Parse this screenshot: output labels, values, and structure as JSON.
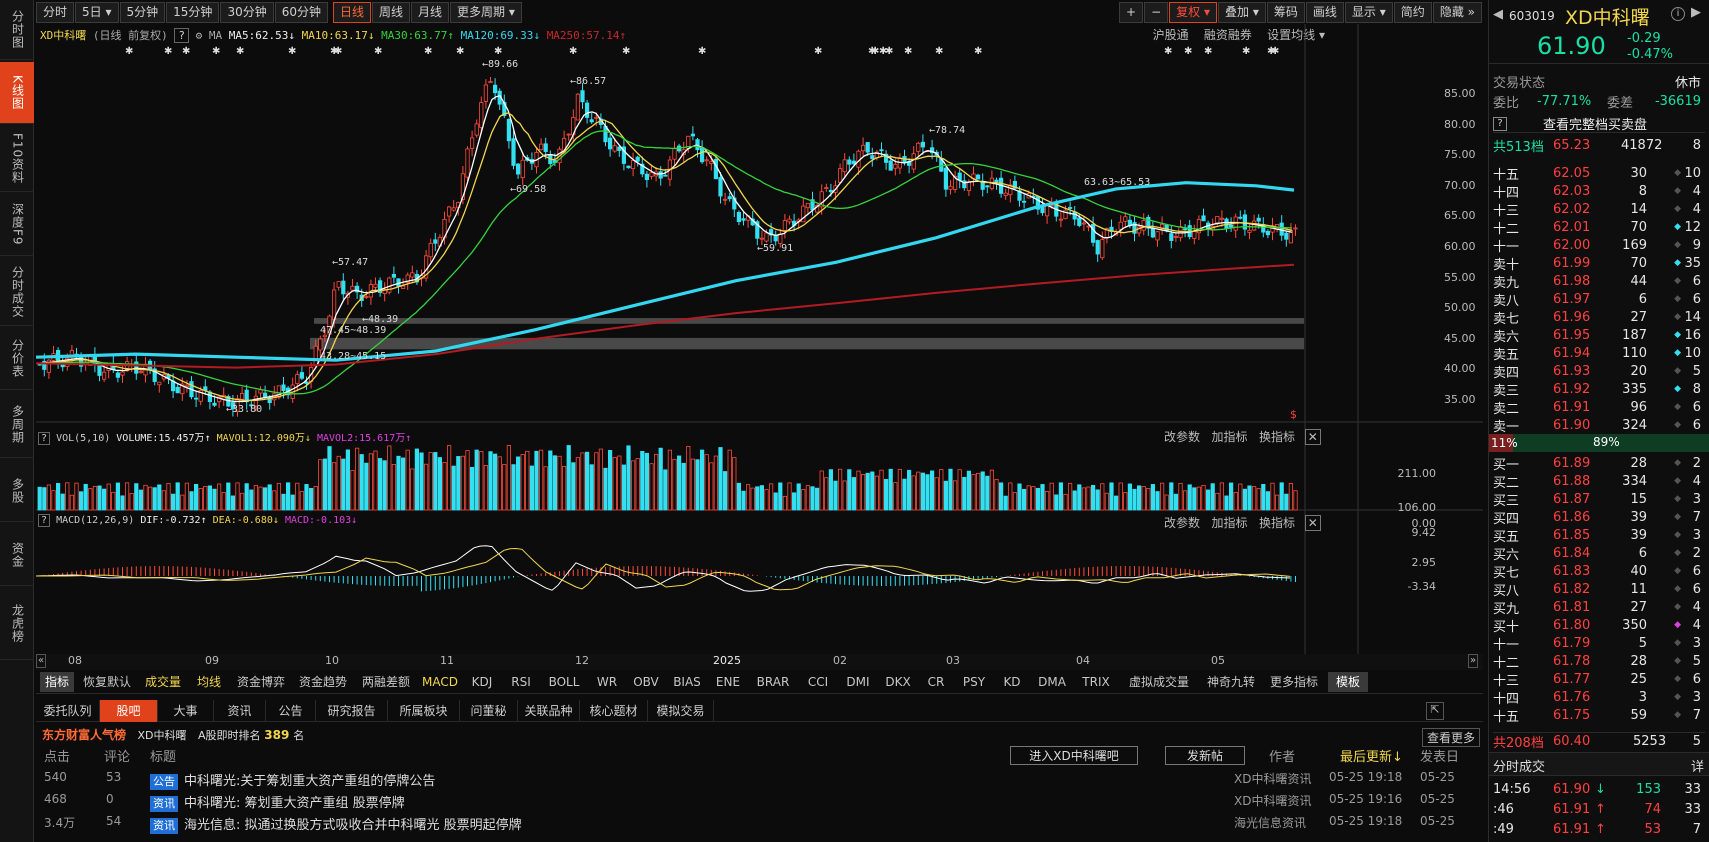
{
  "sidebar": {
    "items": [
      "分时图",
      "K线图",
      "F10资料",
      "深度F9",
      "分时成交",
      "分价表",
      "多周期",
      "多股",
      "资金",
      "龙虎榜"
    ],
    "active_index": 1
  },
  "toolbar": {
    "periods": [
      "分时",
      "5日",
      "5分钟",
      "15分钟",
      "30分钟",
      "60分钟",
      "日线",
      "周线",
      "月线",
      "更多周期"
    ],
    "active_period": "日线",
    "right_buttons": [
      "+",
      "−",
      "复权",
      "叠加",
      "筹码",
      "画线",
      "显示",
      "简约",
      "隐藏"
    ]
  },
  "chart_header": {
    "name": "XD中科曙",
    "mode": "(日线 前复权)",
    "ma_label": "MA",
    "ma5": "MA5:62.53",
    "ma10": "MA10:63.17",
    "ma30": "MA30:63.77",
    "ma120": "MA120:69.33",
    "ma250": "MA250:57.14",
    "links": [
      "沪股通",
      "融资融券",
      "设置均线"
    ]
  },
  "annotations": {
    "high1": "89.66",
    "high2": "86.57",
    "low1": "69.58",
    "high3": "78.74",
    "low2": "59.91",
    "low3": "33.80",
    "mark1": "57.47",
    "gap1": "48.39",
    "gap1b": "47.45~48.39",
    "gap2": "43.28~45.15",
    "gap3": "63.63~65.53"
  },
  "price_axis": [
    "85.00",
    "80.00",
    "75.00",
    "70.00",
    "65.00",
    "60.00",
    "55.00",
    "50.00",
    "45.00",
    "40.00",
    "35.00"
  ],
  "vol_panel": {
    "title": "VOL(5,10)",
    "volume": "VOLUME:15.457万",
    "mavol1": "MAVOL1:12.090万",
    "mavol2": "MAVOL2:15.617万",
    "axis": [
      "211.00",
      "106.00",
      "0.00"
    ],
    "buttons": [
      "改参数",
      "加指标",
      "换指标"
    ]
  },
  "macd_panel": {
    "title": "MACD(12,26,9)",
    "dif": "DIF:-0.732",
    "dea": "DEA:-0.680",
    "macd": "MACD:-0.103",
    "axis": [
      "9.42",
      "2.95",
      "-3.34"
    ],
    "buttons": [
      "改参数",
      "加指标",
      "换指标"
    ]
  },
  "date_axis": [
    "08",
    "09",
    "10",
    "11",
    "12",
    "2025",
    "02",
    "03",
    "04",
    "05"
  ],
  "indicator_tabs": [
    "指标",
    "恢复默认",
    "成交量",
    "均线",
    "资金博弈",
    "资金趋势",
    "两融差额",
    "MACD",
    "KDJ",
    "RSI",
    "BOLL",
    "WR",
    "OBV",
    "BIAS",
    "ENE",
    "BRAR",
    "CCI",
    "DMI",
    "DKX",
    "CR",
    "PSY",
    "KD",
    "DMA",
    "TRIX",
    "虚拟成交量",
    "神奇九转",
    "更多指标",
    "模板"
  ],
  "bottom_tabs": [
    "委托队列",
    "股吧",
    "大事",
    "资讯",
    "公告",
    "研究报告",
    "所属板块",
    "问董秘",
    "关联品种",
    "核心题材",
    "模拟交易"
  ],
  "bottom_active": "股吧",
  "forum": {
    "brand": "东方财富人气榜",
    "stock": "XD中科曙",
    "rank_label": "A股即时排名",
    "rank": "389",
    "rank_unit": "名",
    "more": "查看更多",
    "cols": [
      "点击",
      "评论",
      "标题",
      "作者",
      "最后更新",
      "发表日"
    ],
    "enter_btn": "进入XD中科曙吧",
    "post_btn": "发新帖",
    "rows": [
      {
        "clicks": "540",
        "comments": "53",
        "tag": "公告",
        "title": "中科曙光:关于筹划重大资产重组的停牌公告",
        "author": "XD中科曙资讯",
        "updated": "05-25 19:18",
        "date": "05-25"
      },
      {
        "clicks": "468",
        "comments": "0",
        "tag": "资讯",
        "title": "中科曙光: 筹划重大资产重组 股票停牌",
        "author": "XD中科曙资讯",
        "updated": "05-25 19:16",
        "date": "05-25"
      },
      {
        "clicks": "3.4万",
        "comments": "54",
        "tag": "资讯",
        "title": "海光信息: 拟通过换股方式吸收合并中科曙光 股票明起停牌",
        "author": "海光信息资讯",
        "updated": "05-25 19:18",
        "date": "05-25"
      }
    ]
  },
  "quote": {
    "code": "603019",
    "name": "XD中科曙",
    "price": "61.90",
    "change": "-0.29",
    "change_pct": "-0.47%",
    "status_label": "交易状态",
    "status": "休市",
    "ratio_label": "委比",
    "ratio": "-77.71%",
    "diff_label": "委差",
    "diff": "-36619",
    "full_book": "查看完整档买卖盘",
    "sell_total": {
      "label": "共513档",
      "price": "65.23",
      "vol": "41872",
      "n": "8"
    },
    "sells": [
      {
        "lv": "十五",
        "p": "62.05",
        "v": "30",
        "n": "10"
      },
      {
        "lv": "十四",
        "p": "62.03",
        "v": "8",
        "n": "4"
      },
      {
        "lv": "十三",
        "p": "62.02",
        "v": "14",
        "n": "4"
      },
      {
        "lv": "十二",
        "p": "62.01",
        "v": "70",
        "n": "12"
      },
      {
        "lv": "十一",
        "p": "62.00",
        "v": "169",
        "n": "9"
      },
      {
        "lv": "卖十",
        "p": "61.99",
        "v": "70",
        "n": "35"
      },
      {
        "lv": "卖九",
        "p": "61.98",
        "v": "44",
        "n": "6"
      },
      {
        "lv": "卖八",
        "p": "61.97",
        "v": "6",
        "n": "6"
      },
      {
        "lv": "卖七",
        "p": "61.96",
        "v": "27",
        "n": "14"
      },
      {
        "lv": "卖六",
        "p": "61.95",
        "v": "187",
        "n": "16"
      },
      {
        "lv": "卖五",
        "p": "61.94",
        "v": "110",
        "n": "10"
      },
      {
        "lv": "卖四",
        "p": "61.93",
        "v": "20",
        "n": "5"
      },
      {
        "lv": "卖三",
        "p": "61.92",
        "v": "335",
        "n": "8"
      },
      {
        "lv": "卖二",
        "p": "61.91",
        "v": "96",
        "n": "6"
      },
      {
        "lv": "卖一",
        "p": "61.90",
        "v": "324",
        "n": "6"
      }
    ],
    "split_left": "11%",
    "split_right": "89%",
    "buys": [
      {
        "lv": "买一",
        "p": "61.89",
        "v": "28",
        "n": "2"
      },
      {
        "lv": "买二",
        "p": "61.88",
        "v": "334",
        "n": "4"
      },
      {
        "lv": "买三",
        "p": "61.87",
        "v": "15",
        "n": "3"
      },
      {
        "lv": "买四",
        "p": "61.86",
        "v": "39",
        "n": "7"
      },
      {
        "lv": "买五",
        "p": "61.85",
        "v": "39",
        "n": "3"
      },
      {
        "lv": "买六",
        "p": "61.84",
        "v": "6",
        "n": "2"
      },
      {
        "lv": "买七",
        "p": "61.83",
        "v": "40",
        "n": "6"
      },
      {
        "lv": "买八",
        "p": "61.82",
        "v": "11",
        "n": "6"
      },
      {
        "lv": "买九",
        "p": "61.81",
        "v": "27",
        "n": "4"
      },
      {
        "lv": "买十",
        "p": "61.80",
        "v": "350",
        "n": "4"
      },
      {
        "lv": "十一",
        "p": "61.79",
        "v": "5",
        "n": "3"
      },
      {
        "lv": "十二",
        "p": "61.78",
        "v": "28",
        "n": "5"
      },
      {
        "lv": "十三",
        "p": "61.77",
        "v": "25",
        "n": "6"
      },
      {
        "lv": "十四",
        "p": "61.76",
        "v": "3",
        "n": "3"
      },
      {
        "lv": "十五",
        "p": "61.75",
        "v": "59",
        "n": "7"
      }
    ],
    "buy_total": {
      "label": "共208档",
      "price": "60.40",
      "vol": "5253",
      "n": "5"
    },
    "ticks_title": "分时成交",
    "ticks_more": "详",
    "ticks": [
      {
        "t": "14:56",
        "p": "61.90",
        "v": "153",
        "n": "33"
      },
      {
        "t": ":46",
        "p": "61.91",
        "v": "74",
        "n": "33"
      },
      {
        "t": ":49",
        "p": "61.91",
        "v": "53",
        "n": "7"
      }
    ]
  },
  "chart_data": {
    "type": "candlestick",
    "title": "XD中科曙 日线 前复权",
    "ylim": [
      33,
      90
    ],
    "x_range": [
      "2024-08",
      "2025-05"
    ],
    "ma_last": {
      "MA5": 62.53,
      "MA10": 63.17,
      "MA30": 63.77,
      "MA120": 69.33,
      "MA250": 57.14
    },
    "labelled_extremes": {
      "high": 89.66,
      "high2": 86.57,
      "low_mid": 69.58,
      "high3": 78.74,
      "low_feb": 59.91,
      "low": 33.8,
      "oct": 57.47
    },
    "volume_axis": [
      0,
      106,
      211
    ],
    "macd_axis": [
      -3.34,
      2.95,
      9.42
    ],
    "last": {
      "DIF": -0.732,
      "DEA": -0.68,
      "MACD": -0.103,
      "VOLUME": "15.457万",
      "MAVOL1": "12.090万",
      "MAVOL2": "15.617万"
    }
  }
}
